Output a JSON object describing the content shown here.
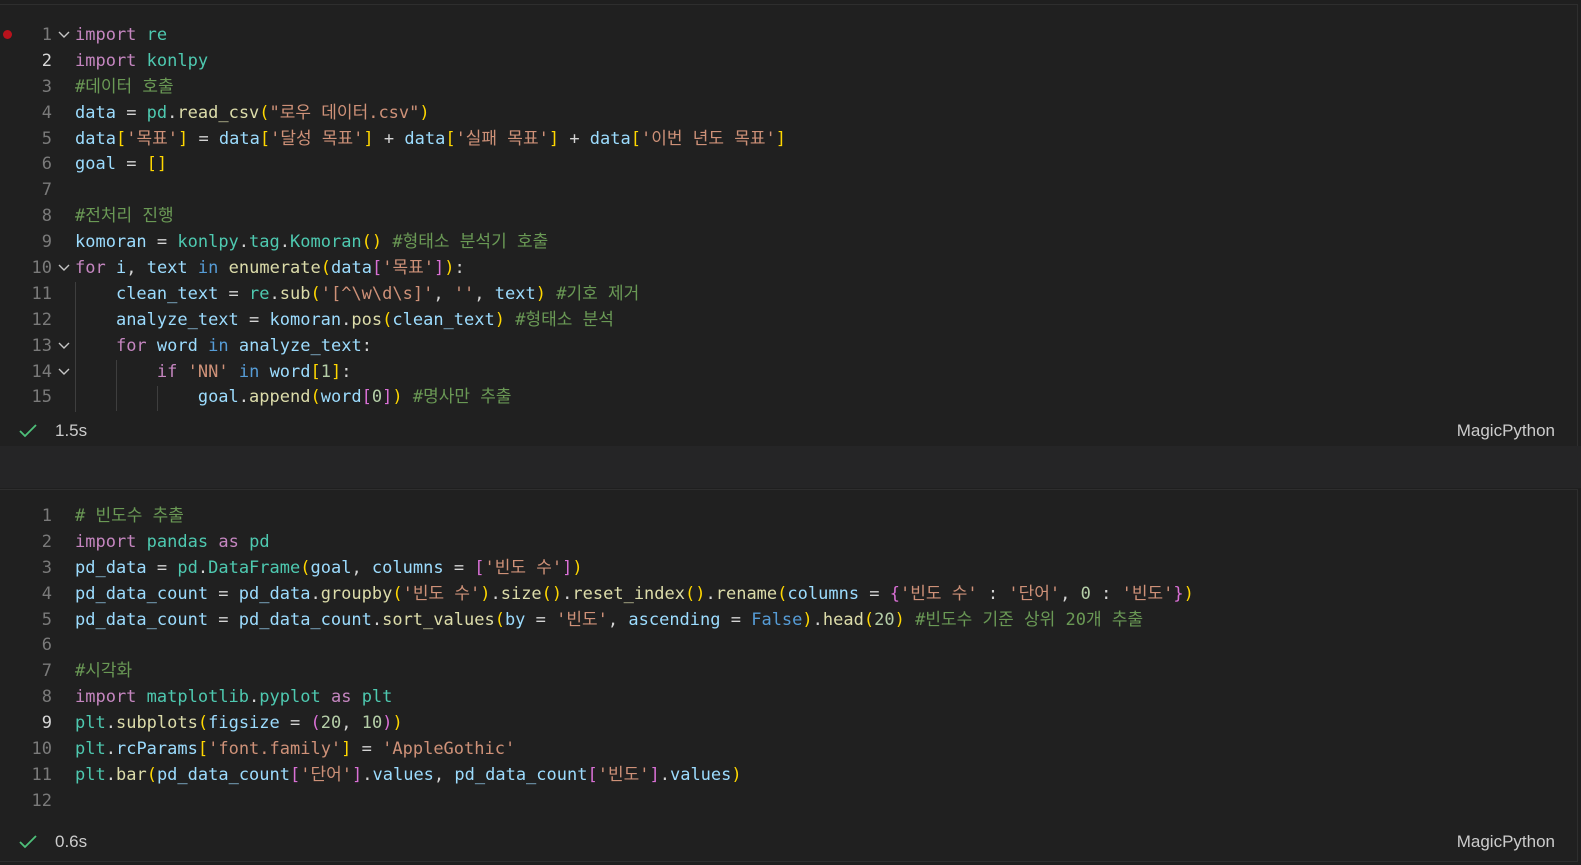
{
  "cells": [
    {
      "status": {
        "time": "1.5s",
        "kernel": "MagicPython"
      },
      "lines": [
        {
          "num": "1",
          "fold": true,
          "tokens": [
            [
              "k",
              "import"
            ],
            [
              "p",
              " "
            ],
            [
              "cls",
              "re"
            ]
          ]
        },
        {
          "num": "2",
          "active": true,
          "tokens": [
            [
              "k",
              "import"
            ],
            [
              "p",
              " "
            ],
            [
              "cls",
              "konlpy"
            ]
          ]
        },
        {
          "num": "3",
          "tokens": [
            [
              "c",
              "#데이터 호출"
            ]
          ]
        },
        {
          "num": "4",
          "tokens": [
            [
              "v",
              "data"
            ],
            [
              "p",
              " = "
            ],
            [
              "cls",
              "pd"
            ],
            [
              "p",
              "."
            ],
            [
              "f",
              "read_csv"
            ],
            [
              "br",
              "("
            ],
            [
              "s",
              "\"로우 데이터.csv\""
            ],
            [
              "br",
              ")"
            ]
          ]
        },
        {
          "num": "5",
          "tokens": [
            [
              "v",
              "data"
            ],
            [
              "br",
              "["
            ],
            [
              "s",
              "'목표'"
            ],
            [
              "br",
              "]"
            ],
            [
              "p",
              " = "
            ],
            [
              "v",
              "data"
            ],
            [
              "br",
              "["
            ],
            [
              "s",
              "'달성 목표'"
            ],
            [
              "br",
              "]"
            ],
            [
              "p",
              " + "
            ],
            [
              "v",
              "data"
            ],
            [
              "br",
              "["
            ],
            [
              "s",
              "'실패 목표'"
            ],
            [
              "br",
              "]"
            ],
            [
              "p",
              " + "
            ],
            [
              "v",
              "data"
            ],
            [
              "br",
              "["
            ],
            [
              "s",
              "'이번 년도 목표'"
            ],
            [
              "br",
              "]"
            ]
          ]
        },
        {
          "num": "6",
          "tokens": [
            [
              "v",
              "goal"
            ],
            [
              "p",
              " = "
            ],
            [
              "br",
              "[]"
            ]
          ]
        },
        {
          "num": "7",
          "tokens": []
        },
        {
          "num": "8",
          "tokens": [
            [
              "c",
              "#전처리 진행"
            ]
          ]
        },
        {
          "num": "9",
          "tokens": [
            [
              "v",
              "komoran"
            ],
            [
              "p",
              " = "
            ],
            [
              "cls",
              "konlpy"
            ],
            [
              "p",
              "."
            ],
            [
              "cls",
              "tag"
            ],
            [
              "p",
              "."
            ],
            [
              "cls",
              "Komoran"
            ],
            [
              "br",
              "()"
            ],
            [
              "p",
              " "
            ],
            [
              "c",
              "#형태소 분석기 호출"
            ]
          ]
        },
        {
          "num": "10",
          "fold": true,
          "tokens": [
            [
              "k",
              "for"
            ],
            [
              "p",
              " "
            ],
            [
              "v",
              "i"
            ],
            [
              "p",
              ", "
            ],
            [
              "v",
              "text"
            ],
            [
              "p",
              " "
            ],
            [
              "kw",
              "in"
            ],
            [
              "p",
              " "
            ],
            [
              "f",
              "enumerate"
            ],
            [
              "br",
              "("
            ],
            [
              "v",
              "data"
            ],
            [
              "br2",
              "["
            ],
            [
              "s",
              "'목표'"
            ],
            [
              "br2",
              "]"
            ],
            [
              "br",
              ")"
            ],
            [
              "p",
              ":"
            ]
          ]
        },
        {
          "num": "11",
          "tokens": [
            [
              "p",
              "    "
            ],
            [
              "v",
              "clean_text"
            ],
            [
              "p",
              " = "
            ],
            [
              "cls",
              "re"
            ],
            [
              "p",
              "."
            ],
            [
              "f",
              "sub"
            ],
            [
              "br",
              "("
            ],
            [
              "s",
              "'[^\\w\\d\\s]'"
            ],
            [
              "p",
              ", "
            ],
            [
              "s",
              "''"
            ],
            [
              "p",
              ", "
            ],
            [
              "v",
              "text"
            ],
            [
              "br",
              ")"
            ],
            [
              "p",
              " "
            ],
            [
              "c",
              "#기호 제거"
            ]
          ]
        },
        {
          "num": "12",
          "tokens": [
            [
              "p",
              "    "
            ],
            [
              "v",
              "analyze_text"
            ],
            [
              "p",
              " = "
            ],
            [
              "v",
              "komoran"
            ],
            [
              "p",
              "."
            ],
            [
              "f",
              "pos"
            ],
            [
              "br",
              "("
            ],
            [
              "v",
              "clean_text"
            ],
            [
              "br",
              ")"
            ],
            [
              "p",
              " "
            ],
            [
              "c",
              "#형태소 분석"
            ]
          ]
        },
        {
          "num": "13",
          "fold": true,
          "tokens": [
            [
              "p",
              "    "
            ],
            [
              "k",
              "for"
            ],
            [
              "p",
              " "
            ],
            [
              "v",
              "word"
            ],
            [
              "p",
              " "
            ],
            [
              "kw",
              "in"
            ],
            [
              "p",
              " "
            ],
            [
              "v",
              "analyze_text"
            ],
            [
              "p",
              ":"
            ]
          ]
        },
        {
          "num": "14",
          "fold": true,
          "tokens": [
            [
              "p",
              "        "
            ],
            [
              "k",
              "if"
            ],
            [
              "p",
              " "
            ],
            [
              "s",
              "'NN'"
            ],
            [
              "p",
              " "
            ],
            [
              "kw",
              "in"
            ],
            [
              "p",
              " "
            ],
            [
              "v",
              "word"
            ],
            [
              "br",
              "["
            ],
            [
              "n",
              "1"
            ],
            [
              "br",
              "]"
            ],
            [
              "p",
              ":"
            ]
          ]
        },
        {
          "num": "15",
          "tokens": [
            [
              "p",
              "            "
            ],
            [
              "v",
              "goal"
            ],
            [
              "p",
              "."
            ],
            [
              "f",
              "append"
            ],
            [
              "br",
              "("
            ],
            [
              "v",
              "word"
            ],
            [
              "br2",
              "["
            ],
            [
              "n",
              "0"
            ],
            [
              "br2",
              "]"
            ],
            [
              "br",
              ")"
            ],
            [
              "p",
              " "
            ],
            [
              "c",
              "#명사만 추출"
            ]
          ]
        }
      ]
    },
    {
      "status": {
        "time": "0.6s",
        "kernel": "MagicPython"
      },
      "lines": [
        {
          "num": "1",
          "tokens": [
            [
              "c",
              "# 빈도수 추출"
            ]
          ]
        },
        {
          "num": "2",
          "tokens": [
            [
              "k",
              "import"
            ],
            [
              "p",
              " "
            ],
            [
              "cls",
              "pandas"
            ],
            [
              "p",
              " "
            ],
            [
              "k",
              "as"
            ],
            [
              "p",
              " "
            ],
            [
              "cls",
              "pd"
            ]
          ]
        },
        {
          "num": "3",
          "tokens": [
            [
              "v",
              "pd_data"
            ],
            [
              "p",
              " = "
            ],
            [
              "cls",
              "pd"
            ],
            [
              "p",
              "."
            ],
            [
              "cls",
              "DataFrame"
            ],
            [
              "br",
              "("
            ],
            [
              "v",
              "goal"
            ],
            [
              "p",
              ", "
            ],
            [
              "v",
              "columns"
            ],
            [
              "p",
              " = "
            ],
            [
              "br2",
              "["
            ],
            [
              "s",
              "'빈도 수'"
            ],
            [
              "br2",
              "]"
            ],
            [
              "br",
              ")"
            ]
          ]
        },
        {
          "num": "4",
          "tokens": [
            [
              "v",
              "pd_data_count"
            ],
            [
              "p",
              " = "
            ],
            [
              "v",
              "pd_data"
            ],
            [
              "p",
              "."
            ],
            [
              "f",
              "groupby"
            ],
            [
              "br",
              "("
            ],
            [
              "s",
              "'빈도 수'"
            ],
            [
              "br",
              ")"
            ],
            [
              "p",
              "."
            ],
            [
              "f",
              "size"
            ],
            [
              "br",
              "()"
            ],
            [
              "p",
              "."
            ],
            [
              "f",
              "reset_index"
            ],
            [
              "br",
              "()"
            ],
            [
              "p",
              "."
            ],
            [
              "f",
              "rename"
            ],
            [
              "br",
              "("
            ],
            [
              "v",
              "columns"
            ],
            [
              "p",
              " = "
            ],
            [
              "br2",
              "{"
            ],
            [
              "s",
              "'빈도 수'"
            ],
            [
              "p",
              " : "
            ],
            [
              "s",
              "'단어'"
            ],
            [
              "p",
              ", "
            ],
            [
              "n",
              "0"
            ],
            [
              "p",
              " : "
            ],
            [
              "s",
              "'빈도'"
            ],
            [
              "br2",
              "}"
            ],
            [
              "br",
              ")"
            ]
          ]
        },
        {
          "num": "5",
          "tokens": [
            [
              "v",
              "pd_data_count"
            ],
            [
              "p",
              " = "
            ],
            [
              "v",
              "pd_data_count"
            ],
            [
              "p",
              "."
            ],
            [
              "f",
              "sort_values"
            ],
            [
              "br",
              "("
            ],
            [
              "v",
              "by"
            ],
            [
              "p",
              " = "
            ],
            [
              "s",
              "'빈도'"
            ],
            [
              "p",
              ", "
            ],
            [
              "v",
              "ascending"
            ],
            [
              "p",
              " = "
            ],
            [
              "kw",
              "False"
            ],
            [
              "br",
              ")"
            ],
            [
              "p",
              "."
            ],
            [
              "f",
              "head"
            ],
            [
              "br",
              "("
            ],
            [
              "n",
              "20"
            ],
            [
              "br",
              ")"
            ],
            [
              "p",
              " "
            ],
            [
              "c",
              "#빈도수 기준 상위 20개 추출"
            ]
          ]
        },
        {
          "num": "6",
          "tokens": []
        },
        {
          "num": "7",
          "tokens": [
            [
              "c",
              "#시각화"
            ]
          ]
        },
        {
          "num": "8",
          "tokens": [
            [
              "k",
              "import"
            ],
            [
              "p",
              " "
            ],
            [
              "cls",
              "matplotlib"
            ],
            [
              "p",
              "."
            ],
            [
              "cls",
              "pyplot"
            ],
            [
              "p",
              " "
            ],
            [
              "k",
              "as"
            ],
            [
              "p",
              " "
            ],
            [
              "cls",
              "plt"
            ]
          ]
        },
        {
          "num": "9",
          "active": true,
          "tokens": [
            [
              "cls",
              "plt"
            ],
            [
              "p",
              "."
            ],
            [
              "f",
              "subplots"
            ],
            [
              "br",
              "("
            ],
            [
              "v",
              "figsize"
            ],
            [
              "p",
              " = "
            ],
            [
              "br2",
              "("
            ],
            [
              "n",
              "20"
            ],
            [
              "p",
              ", "
            ],
            [
              "n",
              "10"
            ],
            [
              "br2",
              ")"
            ],
            [
              "br",
              ")"
            ]
          ]
        },
        {
          "num": "10",
          "tokens": [
            [
              "cls",
              "plt"
            ],
            [
              "p",
              "."
            ],
            [
              "v",
              "rcParams"
            ],
            [
              "br",
              "["
            ],
            [
              "s",
              "'font.family'"
            ],
            [
              "br",
              "]"
            ],
            [
              "p",
              " = "
            ],
            [
              "s",
              "'AppleGothic'"
            ]
          ]
        },
        {
          "num": "11",
          "tokens": [
            [
              "cls",
              "plt"
            ],
            [
              "p",
              "."
            ],
            [
              "f",
              "bar"
            ],
            [
              "br",
              "("
            ],
            [
              "v",
              "pd_data_count"
            ],
            [
              "br2",
              "["
            ],
            [
              "s",
              "'단어'"
            ],
            [
              "br2",
              "]"
            ],
            [
              "p",
              "."
            ],
            [
              "v",
              "values"
            ],
            [
              "p",
              ", "
            ],
            [
              "v",
              "pd_data_count"
            ],
            [
              "br2",
              "["
            ],
            [
              "s",
              "'빈도'"
            ],
            [
              "br2",
              "]"
            ],
            [
              "p",
              "."
            ],
            [
              "v",
              "values"
            ],
            [
              "br",
              ")"
            ]
          ]
        },
        {
          "num": "12",
          "tokens": []
        }
      ]
    }
  ]
}
